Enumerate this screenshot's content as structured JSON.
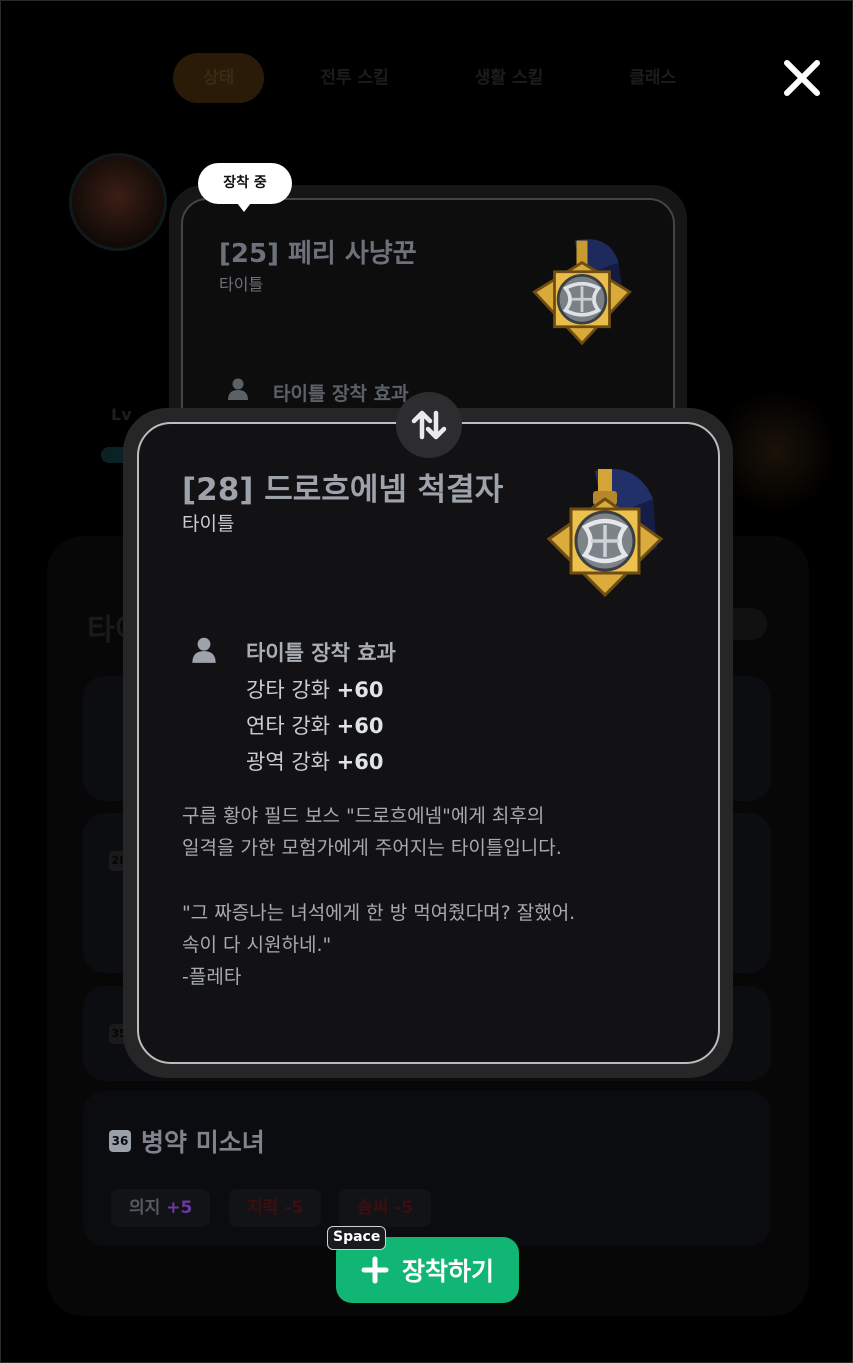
{
  "background": {
    "tabs": [
      "상태",
      "전투 스킬",
      "생활 스킬",
      "클래스"
    ],
    "active_tab": 0,
    "level_label": "Lv",
    "panel_title": "타이",
    "card_numbers": [
      "28",
      "35"
    ],
    "card4": {
      "number": "36",
      "title": "병약 미소녀",
      "stats": [
        {
          "label": "의지",
          "value": "+5",
          "trend": "up"
        },
        {
          "label": "지력",
          "value": "-5",
          "trend": "down"
        },
        {
          "label": "솜씨",
          "value": "-5",
          "trend": "down"
        }
      ]
    }
  },
  "equipped_card": {
    "badge": "장착 중",
    "title": "[25] 페리 사냥꾼",
    "category": "타이틀",
    "effect_label": "타이틀 장착 효과"
  },
  "selected_card": {
    "title": "[28] 드로흐에넴 척결자",
    "category": "타이틀",
    "effect_label": "타이틀 장착 효과",
    "effects": [
      {
        "name": "강타 강화",
        "value": "+60"
      },
      {
        "name": "연타 강화",
        "value": "+60"
      },
      {
        "name": "광역 강화",
        "value": "+60"
      }
    ],
    "description_lines": [
      "구름 황야 필드 보스 \"드로흐에넴\"에게 최후의",
      "일격을 가한 모험가에게 주어지는 타이틀입니다.",
      "",
      "\"그 짜증나는 녀석에게 한 방 먹여줬다며? 잘했어.",
      "속이 다 시원하네.\"",
      "-플레타"
    ]
  },
  "actions": {
    "equip_label": "장착하기",
    "equip_shortcut": "Space",
    "swap_icon": "swap-vertical-icon",
    "close_icon": "close-icon"
  },
  "colors": {
    "accent_green": "#11b574",
    "stat_up": "#6a3aa0",
    "stat_down": "#3c0e10"
  }
}
